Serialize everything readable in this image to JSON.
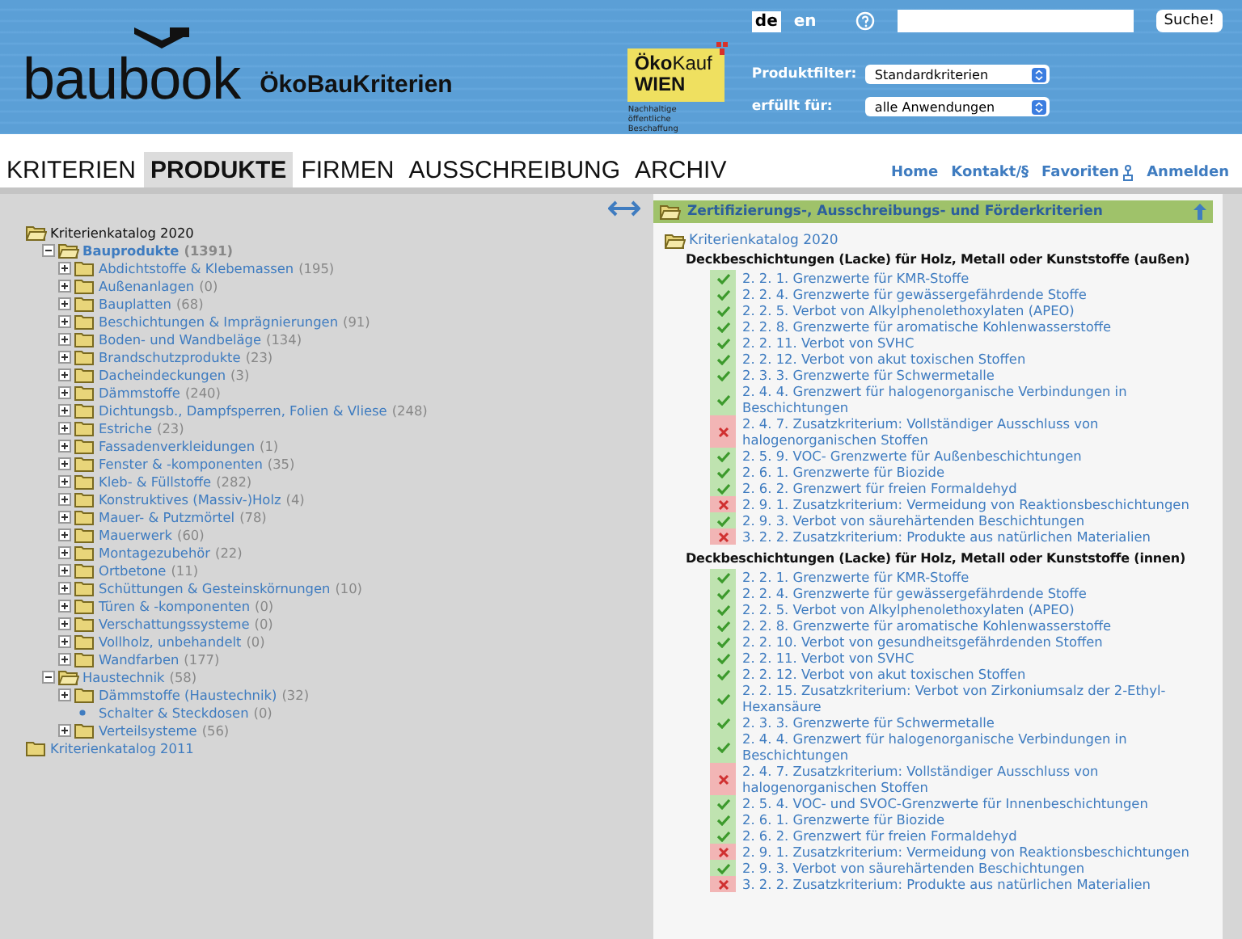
{
  "header": {
    "logo": "baubook",
    "subtitle": "ÖkoBauKriterien",
    "languages": [
      {
        "label": "de",
        "selected": true
      },
      {
        "label": "en",
        "selected": false
      }
    ],
    "search": {
      "button": "Suche!"
    },
    "partner": {
      "first": "Öko",
      "second": "Kauf",
      "city": "WIEN",
      "tagline": "Nachhaltige öffentliche Beschaffung"
    },
    "filters": [
      {
        "label": "Produktfilter:",
        "value": "Standardkriterien"
      },
      {
        "label": "erfüllt für:",
        "value": "alle Anwendungen"
      }
    ]
  },
  "nav": {
    "tabs": [
      {
        "label": "KRITERIEN",
        "selected": false
      },
      {
        "label": "PRODUKTE",
        "selected": true
      },
      {
        "label": "FIRMEN",
        "selected": false
      },
      {
        "label": "AUSSCHREIBUNG",
        "selected": false
      },
      {
        "label": "ARCHIV",
        "selected": false
      }
    ],
    "links": [
      {
        "label": "Home",
        "kind": "text"
      },
      {
        "label": "Kontakt/§",
        "kind": "text"
      },
      {
        "label": "Favoriten",
        "kind": "favorite"
      },
      {
        "label": "Anmelden",
        "kind": "text"
      }
    ]
  },
  "tree": [
    {
      "label": "Kriterienkatalog 2020",
      "kind": "root",
      "selected": true,
      "expanded": true,
      "children": [
        {
          "label": "Bauprodukte",
          "count": "(1391)",
          "kind": "folder",
          "selected": true,
          "expanded": true,
          "children": [
            {
              "label": "Abdichtstoffe & Klebemassen",
              "count": "(195)",
              "kind": "folder",
              "selected": false,
              "expanded": false
            },
            {
              "label": "Außenanlagen",
              "count": "(0)",
              "kind": "folder",
              "selected": false,
              "expanded": false
            },
            {
              "label": "Bauplatten",
              "count": "(68)",
              "kind": "folder",
              "selected": false,
              "expanded": false
            },
            {
              "label": "Beschichtungen & Imprägnierungen",
              "count": "(91)",
              "kind": "folder",
              "selected": false,
              "expanded": false
            },
            {
              "label": "Boden- und Wandbeläge",
              "count": "(134)",
              "kind": "folder",
              "selected": false,
              "expanded": false
            },
            {
              "label": "Brandschutzprodukte",
              "count": "(23)",
              "kind": "folder",
              "selected": false,
              "expanded": false
            },
            {
              "label": "Dacheindeckungen",
              "count": "(3)",
              "kind": "folder",
              "selected": false,
              "expanded": false
            },
            {
              "label": "Dämmstoffe",
              "count": "(240)",
              "kind": "folder",
              "selected": false,
              "expanded": false
            },
            {
              "label": "Dichtungsb., Dampfsperren, Folien & Vliese",
              "count": "(248)",
              "kind": "folder",
              "selected": false,
              "expanded": false
            },
            {
              "label": "Estriche",
              "count": "(23)",
              "kind": "folder",
              "selected": false,
              "expanded": false
            },
            {
              "label": "Fassadenverkleidungen",
              "count": "(1)",
              "kind": "folder",
              "selected": false,
              "expanded": false
            },
            {
              "label": "Fenster & -komponenten",
              "count": "(35)",
              "kind": "folder",
              "selected": false,
              "expanded": false
            },
            {
              "label": "Kleb- & Füllstoffe",
              "count": "(282)",
              "kind": "folder",
              "selected": false,
              "expanded": false
            },
            {
              "label": "Konstruktives (Massiv-)Holz",
              "count": "(4)",
              "kind": "folder",
              "selected": false,
              "expanded": false
            },
            {
              "label": "Mauer- & Putzmörtel",
              "count": "(78)",
              "kind": "folder",
              "selected": false,
              "expanded": false
            },
            {
              "label": "Mauerwerk",
              "count": "(60)",
              "kind": "folder",
              "selected": false,
              "expanded": false
            },
            {
              "label": "Montagezubehör",
              "count": "(22)",
              "kind": "folder",
              "selected": false,
              "expanded": false
            },
            {
              "label": "Ortbetone",
              "count": "(11)",
              "kind": "folder",
              "selected": false,
              "expanded": false
            },
            {
              "label": "Schüttungen & Gesteinskörnungen",
              "count": "(10)",
              "kind": "folder",
              "selected": false,
              "expanded": false
            },
            {
              "label": "Türen & -komponenten",
              "count": "(0)",
              "kind": "folder",
              "selected": false,
              "expanded": false
            },
            {
              "label": "Verschattungssysteme",
              "count": "(0)",
              "kind": "folder",
              "selected": false,
              "expanded": false
            },
            {
              "label": "Vollholz, unbehandelt",
              "count": "(0)",
              "kind": "folder",
              "selected": false,
              "expanded": false
            },
            {
              "label": "Wandfarben",
              "count": "(177)",
              "kind": "folder",
              "selected": false,
              "expanded": false
            }
          ]
        },
        {
          "label": "Haustechnik",
          "count": "(58)",
          "kind": "folder",
          "selected": false,
          "expanded": true,
          "children": [
            {
              "label": "Dämmstoffe (Haustechnik)",
              "count": "(32)",
              "kind": "folder",
              "selected": false,
              "expanded": false
            },
            {
              "label": "Schalter & Steckdosen",
              "count": "(0)",
              "kind": "leaf",
              "selected": false
            },
            {
              "label": "Verteilsysteme",
              "count": "(56)",
              "kind": "folder",
              "selected": false,
              "expanded": false
            }
          ]
        }
      ]
    },
    {
      "label": "Kriterienkatalog 2011",
      "kind": "root",
      "selected": false,
      "expanded": false
    }
  ],
  "panel": {
    "title": "Zertifizierungs-, Ausschreibungs- und Förderkriterien",
    "catalog": "Kriterienkatalog 2020",
    "groups": [
      {
        "title": "Deckbeschichtungen (Lacke) für Holz, Metall oder Kunststoffe (außen)",
        "criteria": [
          {
            "text": "2. 2. 1. Grenzwerte für KMR-Stoffe",
            "passed": true
          },
          {
            "text": "2. 2. 4. Grenzwerte für gewässergefährdende Stoffe",
            "passed": true
          },
          {
            "text": "2. 2. 5. Verbot von Alkylphenolethoxylaten (APEO)",
            "passed": true
          },
          {
            "text": "2. 2. 8. Grenzwerte für aromatische Kohlenwasserstoffe",
            "passed": true
          },
          {
            "text": "2. 2. 11. Verbot von SVHC",
            "passed": true
          },
          {
            "text": "2. 2. 12. Verbot von akut toxischen Stoffen",
            "passed": true
          },
          {
            "text": "2. 3. 3. Grenzwerte für Schwermetalle",
            "passed": true
          },
          {
            "text": "2. 4. 4. Grenzwert für halogenorganische Verbindungen in Beschichtungen",
            "passed": true
          },
          {
            "text": "2. 4. 7. Zusatzkriterium: Vollständiger Ausschluss von halogenorganischen Stoffen",
            "passed": false
          },
          {
            "text": "2. 5. 9. VOC- Grenzwerte für Außenbeschichtungen",
            "passed": true
          },
          {
            "text": "2. 6. 1. Grenzwerte für Biozide",
            "passed": true
          },
          {
            "text": "2. 6. 2. Grenzwert für freien Formaldehyd",
            "passed": true
          },
          {
            "text": "2. 9. 1. Zusatzkriterium: Vermeidung von Reaktionsbeschichtungen",
            "passed": false
          },
          {
            "text": "2. 9. 3. Verbot von säurehärtenden Beschichtungen",
            "passed": true
          },
          {
            "text": "3. 2. 2. Zusatzkriterium: Produkte aus natürlichen Materialien",
            "passed": false
          }
        ]
      },
      {
        "title": "Deckbeschichtungen (Lacke) für Holz, Metall oder Kunststoffe (innen)",
        "criteria": [
          {
            "text": "2. 2. 1. Grenzwerte für KMR-Stoffe",
            "passed": true
          },
          {
            "text": "2. 2. 4. Grenzwerte für gewässergefährdende Stoffe",
            "passed": true
          },
          {
            "text": "2. 2. 5. Verbot von Alkylphenolethoxylaten (APEO)",
            "passed": true
          },
          {
            "text": "2. 2. 8. Grenzwerte für aromatische Kohlenwasserstoffe",
            "passed": true
          },
          {
            "text": "2. 2. 10. Verbot von gesundheitsgefährdenden Stoffen",
            "passed": true
          },
          {
            "text": "2. 2. 11. Verbot von SVHC",
            "passed": true
          },
          {
            "text": "2. 2. 12. Verbot von akut toxischen Stoffen",
            "passed": true
          },
          {
            "text": "2. 2. 15. Zusatzkriterium: Verbot von Zirkoniumsalz der 2-Ethyl-Hexansäure",
            "passed": true
          },
          {
            "text": "2. 3. 3. Grenzwerte für Schwermetalle",
            "passed": true
          },
          {
            "text": "2. 4. 4. Grenzwert für halogenorganische Verbindungen in Beschichtungen",
            "passed": true
          },
          {
            "text": "2. 4. 7. Zusatzkriterium: Vollständiger Ausschluss von halogenorganischen Stoffen",
            "passed": false
          },
          {
            "text": "2. 5. 4. VOC- und SVOC-Grenzwerte für Innenbeschichtungen",
            "passed": true
          },
          {
            "text": "2. 6. 1. Grenzwerte für Biozide",
            "passed": true
          },
          {
            "text": "2. 6. 2. Grenzwert für freien Formaldehyd",
            "passed": true
          },
          {
            "text": "2. 9. 1. Zusatzkriterium: Vermeidung von Reaktionsbeschichtungen",
            "passed": false
          },
          {
            "text": "2. 9. 3. Verbot von säurehärtenden Beschichtungen",
            "passed": true
          },
          {
            "text": "3. 2. 2. Zusatzkriterium: Produkte aus natürlichen Materialien",
            "passed": false
          }
        ]
      }
    ]
  }
}
